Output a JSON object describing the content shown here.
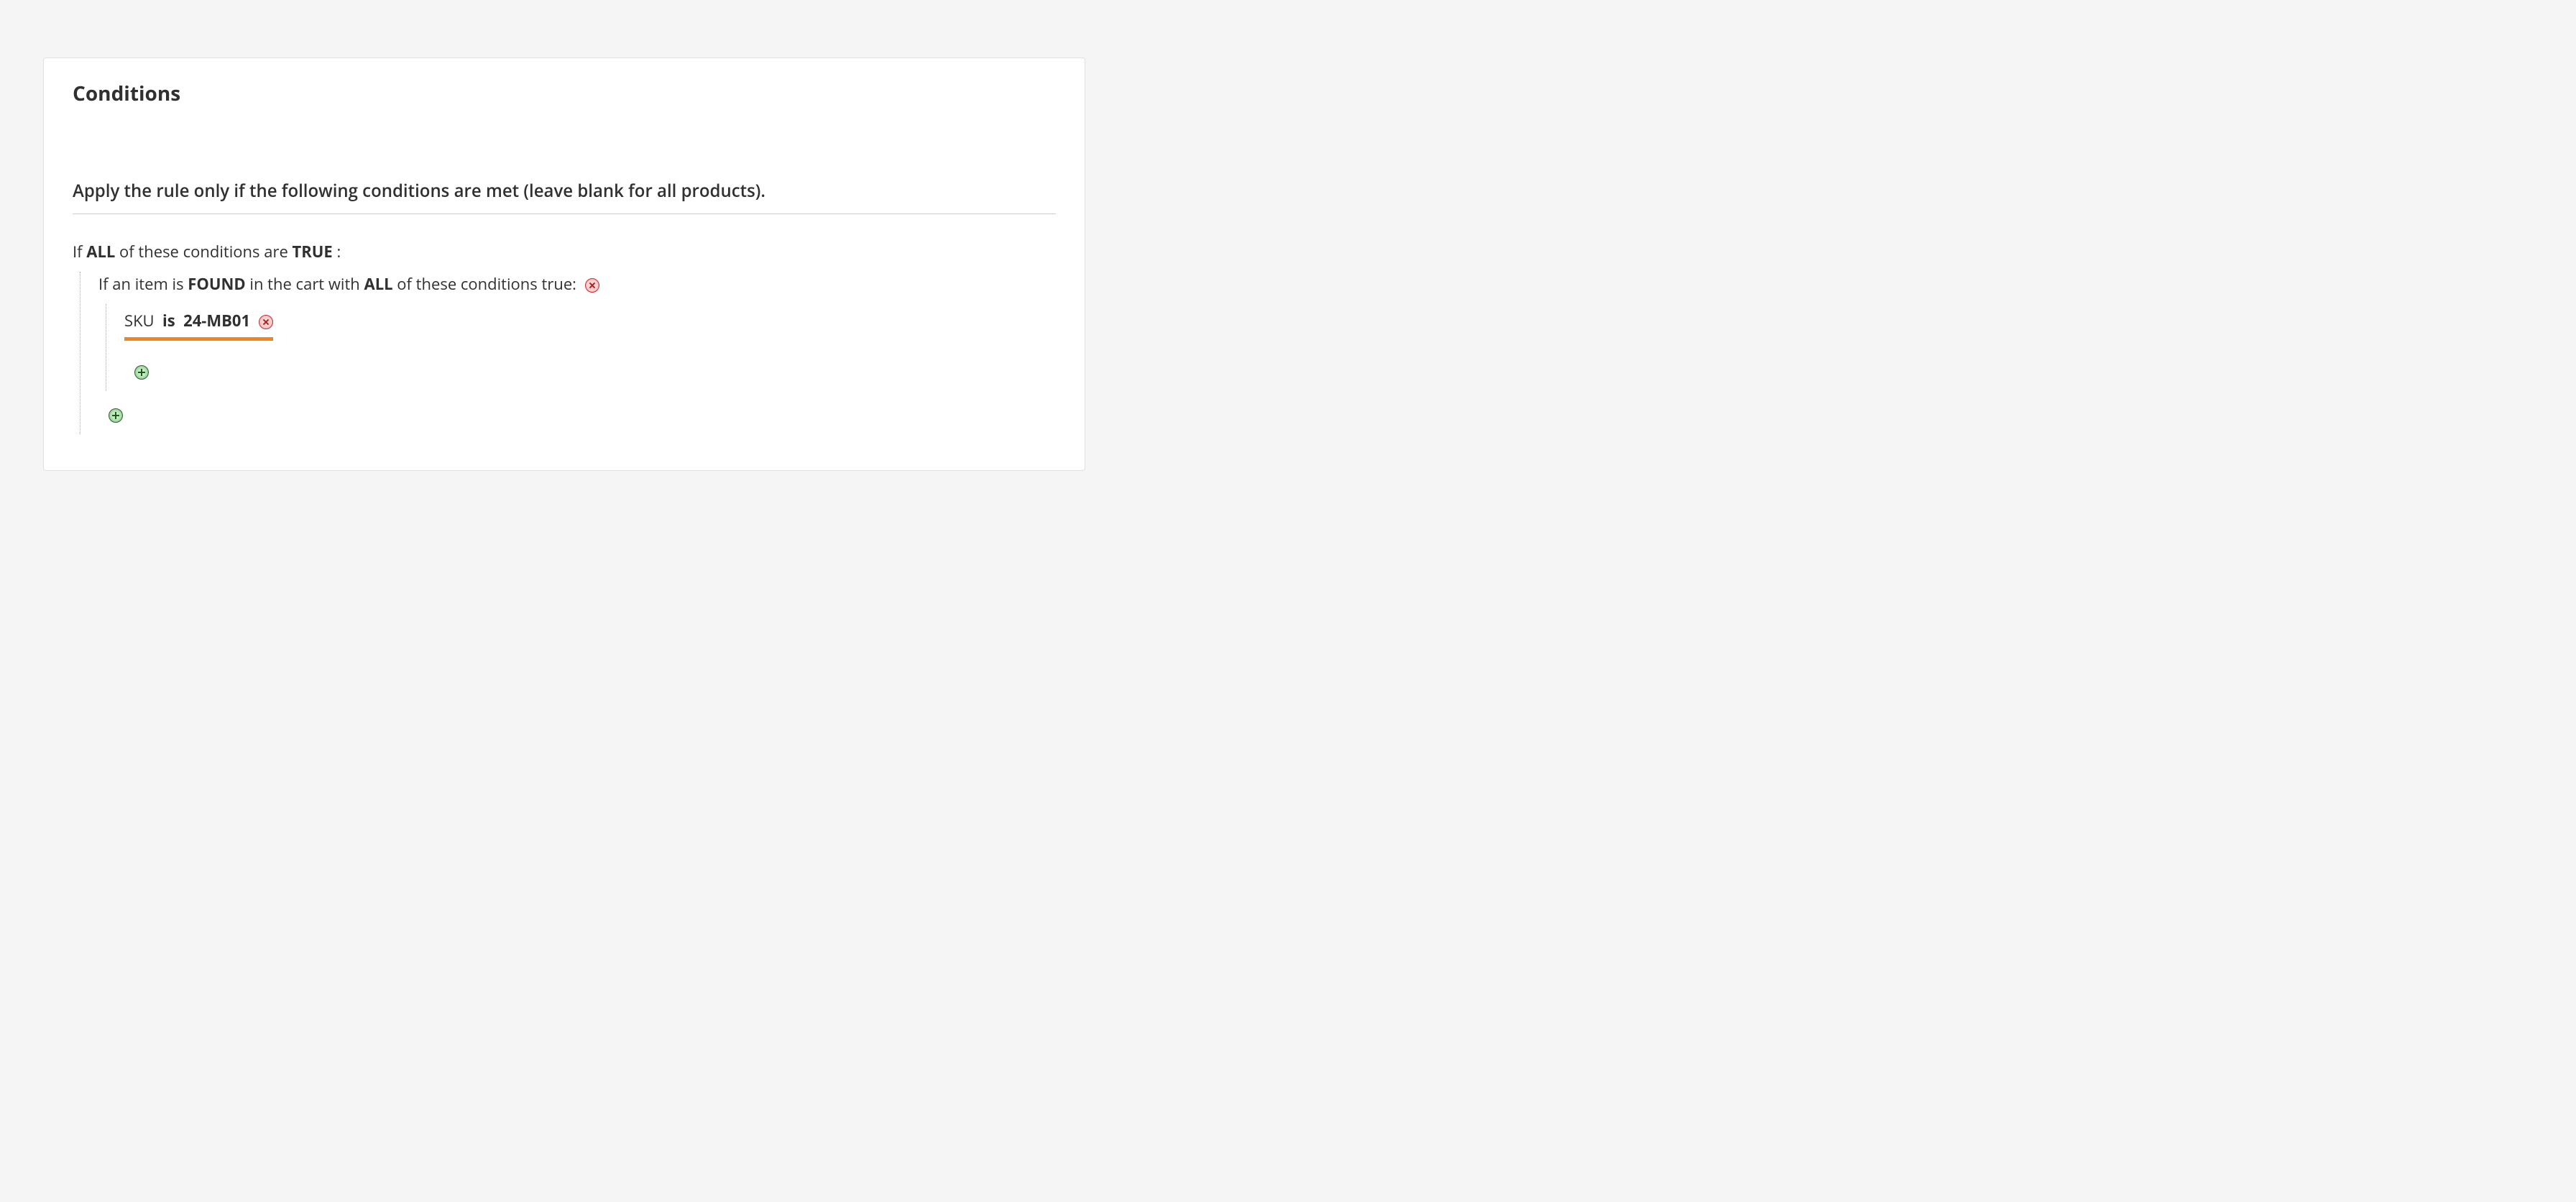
{
  "panel": {
    "title": "Conditions",
    "section_label": "Apply the rule only if the following conditions are met (leave blank for all products)."
  },
  "rule": {
    "root": {
      "prefix": "If",
      "aggregator": "ALL",
      "middle": " of these conditions are",
      "value": "TRUE",
      "suffix": ":"
    },
    "combine": {
      "prefix": "If an item is",
      "found": "FOUND",
      "middle": " in the cart with",
      "aggregator": "ALL",
      "suffix": " of these conditions true:"
    },
    "condition": {
      "attribute": "SKU",
      "operator": "is",
      "value": "24-MB01"
    }
  }
}
